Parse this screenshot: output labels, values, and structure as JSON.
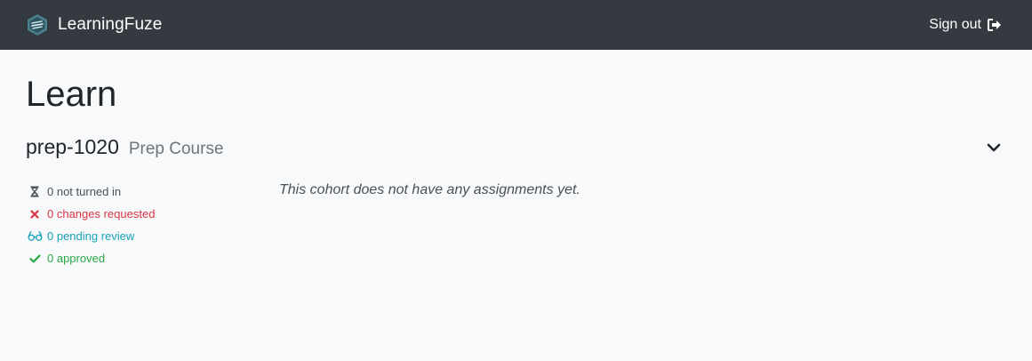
{
  "navbar": {
    "brand": "LearningFuze",
    "signout_label": "Sign out"
  },
  "page": {
    "title": "Learn"
  },
  "cohort": {
    "name": "prep-1020",
    "course": "Prep Course",
    "empty_message": "This cohort does not have any assignments yet.",
    "statuses": [
      {
        "label": "0 not turned in",
        "icon": "hourglass-icon",
        "color": "#495057"
      },
      {
        "label": "0 changes requested",
        "icon": "x-icon",
        "color": "#dc3545"
      },
      {
        "label": "0 pending review",
        "icon": "glasses-icon",
        "color": "#17a2b8"
      },
      {
        "label": "0 approved",
        "icon": "check-icon",
        "color": "#28a745"
      }
    ]
  },
  "colors": {
    "navbar_bg": "#343a40",
    "page_bg": "#f8f9fa",
    "muted": "#6c757d"
  }
}
